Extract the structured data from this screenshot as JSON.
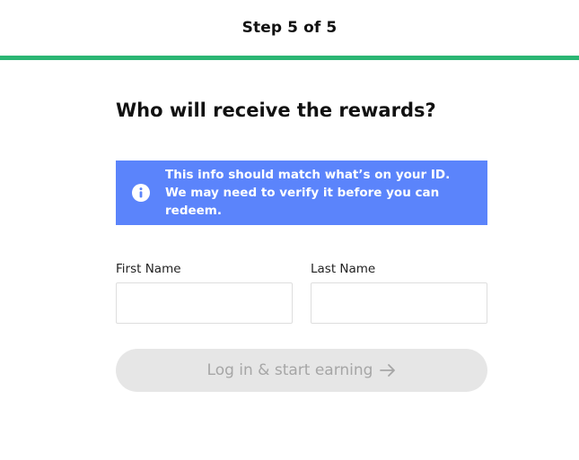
{
  "header": {
    "step_text": "Step 5 of 5",
    "progress_fraction": 1.0,
    "progress_color": "#2bb673"
  },
  "main": {
    "question": "Who will receive the rewards?",
    "notice": {
      "icon": "info-icon",
      "text": "This info should match what’s on your ID. We may need to verify it before you can redeem.",
      "background_color": "#5b84fb"
    },
    "fields": {
      "first_name": {
        "label": "First Name",
        "value": "",
        "placeholder": ""
      },
      "last_name": {
        "label": "Last Name",
        "value": "",
        "placeholder": ""
      }
    },
    "submit": {
      "label": "Log in & start earning",
      "icon": "arrow-right-icon",
      "state": "disabled"
    }
  }
}
